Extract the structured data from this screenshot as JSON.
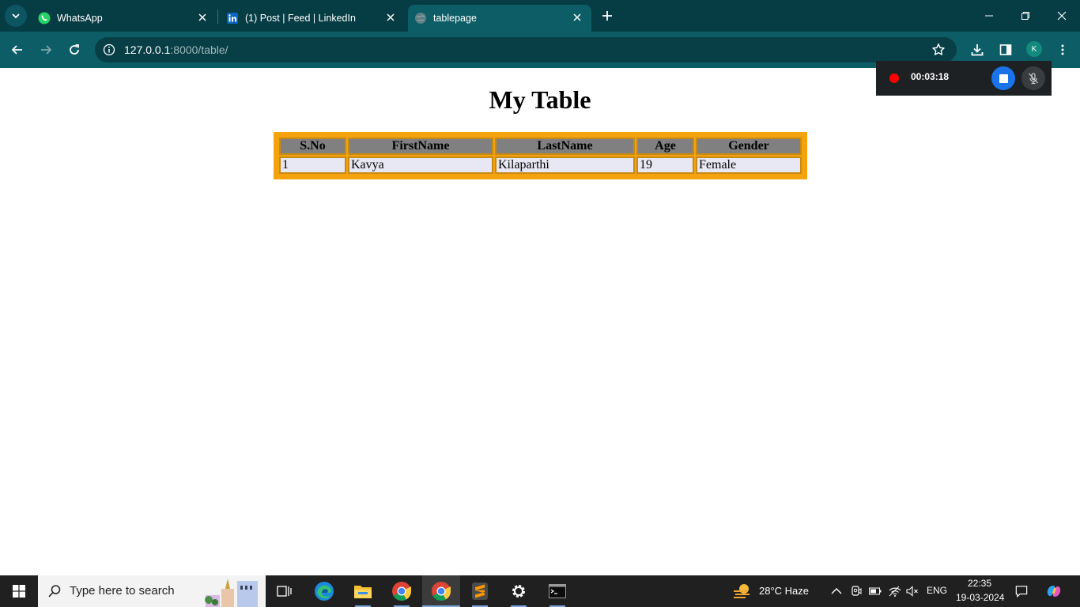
{
  "browser": {
    "tabs": [
      {
        "title": "WhatsApp",
        "icon": "whatsapp-icon"
      },
      {
        "title": "(1) Post | Feed | LinkedIn",
        "icon": "linkedin-icon"
      },
      {
        "title": "tablepage",
        "icon": "globe-icon",
        "active": true
      }
    ],
    "url_host": "127.0.0.1",
    "url_path": ":8000/table/",
    "profile_initial": "K"
  },
  "recorder": {
    "time": "00:03:18"
  },
  "page": {
    "title": "My Table",
    "table": {
      "headers": [
        "S.No",
        "FirstName",
        "LastName",
        "Age",
        "Gender"
      ],
      "rows": [
        [
          "1",
          "Kavya",
          "Kilaparthi",
          "19",
          "Female"
        ]
      ]
    }
  },
  "taskbar": {
    "search_placeholder": "Type here to search",
    "weather": "28°C  Haze",
    "language": "ENG",
    "time": "22:35",
    "date": "19-03-2024"
  },
  "colors": {
    "tabbar": "#063c44",
    "toolbar": "#0d5d66",
    "table_border": "#f5a30c",
    "header_cell": "#808080",
    "data_cell": "#e8e8f4"
  }
}
